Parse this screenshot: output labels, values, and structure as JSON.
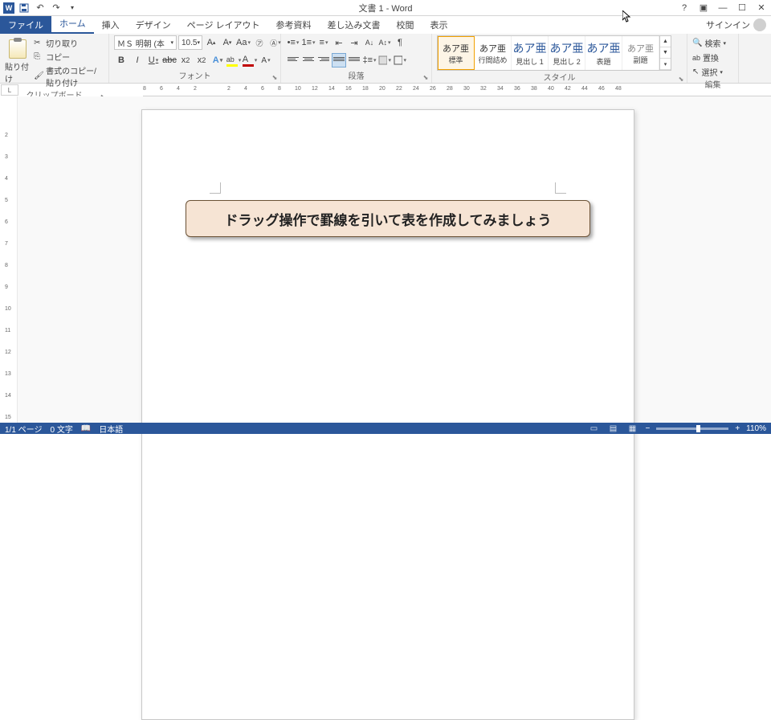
{
  "title": "文書 1 - Word",
  "window": {
    "help": "?",
    "restore": "▣",
    "min": "—",
    "max": "☐",
    "close": "✕"
  },
  "tabs": {
    "file": "ファイル",
    "items": [
      "ホーム",
      "挿入",
      "デザイン",
      "ページ レイアウト",
      "参考資料",
      "差し込み文書",
      "校閲",
      "表示"
    ],
    "signin": "サインイン"
  },
  "clipboard": {
    "paste": "貼り付け",
    "cut": "切り取り",
    "copy": "コピー",
    "formatpainter": "書式のコピー/貼り付け",
    "label": "クリップボード"
  },
  "font": {
    "name": "ＭＳ 明朝 (本",
    "size": "10.5",
    "label": "フォント"
  },
  "paragraph": {
    "label": "段落"
  },
  "styles": {
    "label": "スタイル",
    "sample": "あア亜",
    "items": [
      "標準",
      "行間詰め",
      "見出し 1",
      "見出し 2",
      "表題",
      "副題"
    ]
  },
  "editing": {
    "find": "検索",
    "replace": "置換",
    "select": "選択",
    "label": "編集"
  },
  "document": {
    "callout": "ドラッグ操作で罫線を引いて表を作成してみましょう"
  },
  "ruler": {
    "marks": [
      "8",
      "6",
      "4",
      "2",
      "",
      "2",
      "4",
      "6",
      "8",
      "10",
      "12",
      "14",
      "16",
      "18",
      "20",
      "22",
      "24",
      "26",
      "28",
      "30",
      "32",
      "34",
      "36",
      "38",
      "40",
      "42",
      "44",
      "46",
      "48"
    ]
  },
  "vruler": {
    "marks": [
      "",
      "2",
      "3",
      "4",
      "5",
      "6",
      "7",
      "8",
      "9",
      "10",
      "11",
      "12",
      "13",
      "14",
      "15"
    ]
  },
  "status": {
    "page": "1/1 ページ",
    "words": "0 文字",
    "lang": "日本語",
    "zoom": "110%"
  }
}
